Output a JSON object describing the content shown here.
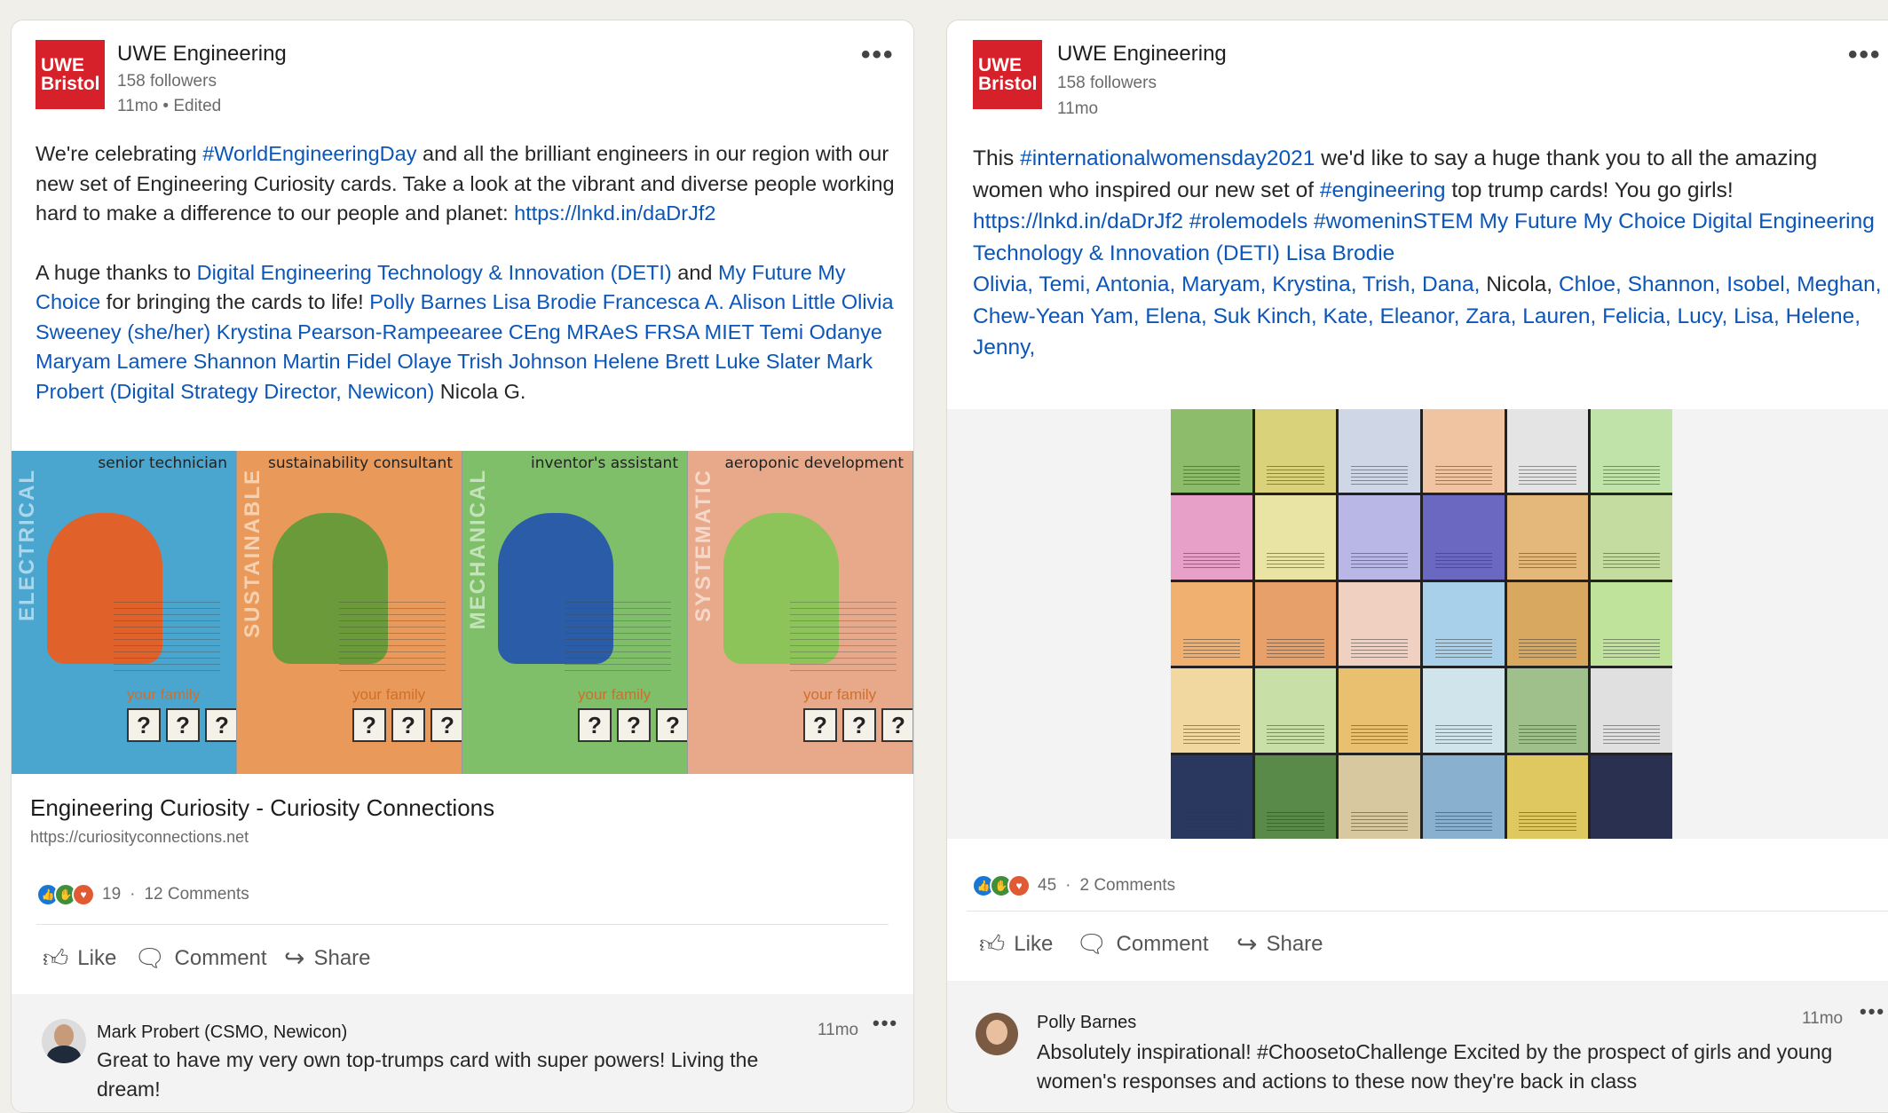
{
  "posts": [
    {
      "logo": [
        "UWE",
        "Bristol"
      ],
      "author": "UWE Engineering",
      "followers": "158 followers",
      "time": "11mo • Edited",
      "more": "•••",
      "body": {
        "para1": [
          {
            "t": "We're celebrating ",
            "link": false
          },
          {
            "t": "#WorldEngineeringDay",
            "link": true
          },
          {
            "t": " and all the brilliant engineers in our region with our new set of Engineering Curiosity cards. Take a look at the vibrant and diverse people working hard to make a difference to our people and planet: ",
            "link": false
          },
          {
            "t": "https://lnkd.in/daDrJf2",
            "link": true
          }
        ],
        "para2": [
          {
            "t": "A huge thanks to ",
            "link": false
          },
          {
            "t": "Digital Engineering Technology & Innovation (DETI)",
            "link": true
          },
          {
            "t": " and ",
            "link": false
          },
          {
            "t": "My Future My Choice",
            "link": true
          },
          {
            "t": " for bringing the cards to life! ",
            "link": false
          },
          {
            "t": "Polly Barnes Lisa Brodie Francesca A. Alison Little Olivia Sweeney (she/her) Krystina Pearson-Rampeearee CEng MRAeS FRSA MIET Temi Odanye Maryam Lamere Shannon Martin Fidel Olaye Trish Johnson Helene Brett Luke Slater Mark Probert (Digital Strategy Director, Newicon)",
            "link": true
          },
          {
            "t": " Nicola G.",
            "link": false
          }
        ]
      },
      "cards": [
        {
          "role": "senior technician",
          "side": "ELECTRICAL",
          "family": "your family",
          "qs": [
            "?",
            "?",
            "?"
          ],
          "color": "#4aa6cf",
          "accent": "#e0612a"
        },
        {
          "role": "sustainability consultant",
          "side": "SUSTAINABLE",
          "family": "your family",
          "qs": [
            "?",
            "?",
            "?"
          ],
          "color": "#e99a5a",
          "accent": "#6a9a3a"
        },
        {
          "role": "inventor's assistant",
          "side": "MECHANICAL",
          "family": "your family",
          "qs": [
            "?",
            "?",
            "?"
          ],
          "color": "#7fbf6a",
          "accent": "#2b5ca8"
        },
        {
          "role": "aeroponic development",
          "side": "SYSTEMATIC",
          "family": "your family",
          "qs": [
            "?",
            "?",
            "?"
          ],
          "color": "#e8a98a",
          "accent": "#8dc45a"
        }
      ],
      "link_title": "Engineering Curiosity - Curiosity Connections",
      "link_url": "https://curiosityconnections.net",
      "reaction_count": "19",
      "comments_count": "12 Comments",
      "actions": {
        "like": "Like",
        "comment": "Comment",
        "share": "Share"
      },
      "comment": {
        "author": "Mark Probert (CSMO, Newicon)",
        "time": "11mo",
        "more": "•••",
        "text": "Great to have my very own top-trumps card with super powers! Living the dream!"
      }
    },
    {
      "logo": [
        "UWE",
        "Bristol"
      ],
      "author": "UWE Engineering",
      "followers": "158 followers",
      "time": "11mo",
      "more": "•••",
      "body": {
        "para1": [
          {
            "t": "This ",
            "link": false
          },
          {
            "t": "#internationalwomensday2021",
            "link": true
          },
          {
            "t": " we'd like to say a huge thank you to all the amazing women who inspired our new set of ",
            "link": false
          },
          {
            "t": "#engineering",
            "link": true
          },
          {
            "t": " top trump cards! You go girls! ",
            "link": false
          },
          {
            "t": "https://lnkd.in/daDrJf2 #rolemodels #womeninSTEM My Future My Choice Digital Engineering Technology & Innovation (DETI) Lisa Brodie",
            "link": true
          }
        ],
        "para2": [
          {
            "t": "Olivia, Temi, Antonia, Maryam, Krystina, Trish, Dana,",
            "link": true
          },
          {
            "t": " Nicola, ",
            "link": false
          },
          {
            "t": "Chloe, Shannon, Isobel, Meghan, Chew-Yean Yam, Elena, Suk Kinch, Kate, Eleanor, Zara, Lauren, Felicia, Lucy, Lisa, Helene, Jenny,",
            "link": true
          }
        ]
      },
      "collage_colors": [
        "#8dbd6a",
        "#d9d27a",
        "#cfd7e6",
        "#f0c4a0",
        "#e4e4e4",
        "#bfe3a8",
        "#e7a0c8",
        "#e9e4a3",
        "#b9b7e6",
        "#6a68c0",
        "#e3b87a",
        "#c5dca1",
        "#f0b070",
        "#e8a06a",
        "#f0d0c0",
        "#a8d0ea",
        "#d8a860",
        "#bfe39a",
        "#f0d8a0",
        "#c8e0a8",
        "#e8c070",
        "#d0e4ec",
        "#9fc08a",
        "#e0e0e0",
        "#2a3860",
        "#5a8a4a",
        "#d8c8a0",
        "#8ab0d0",
        "#e0c860",
        "#2a3050"
      ],
      "reaction_count": "45",
      "comments_count": "2 Comments",
      "actions": {
        "like": "Like",
        "comment": "Comment",
        "share": "Share"
      },
      "comment": {
        "author": "Polly Barnes",
        "time": "11mo",
        "more": "•••",
        "text": "Absolutely inspirational! #ChoosetoChallenge Excited by the prospect of girls and young women's responses and actions to these now they're back in class"
      }
    }
  ]
}
